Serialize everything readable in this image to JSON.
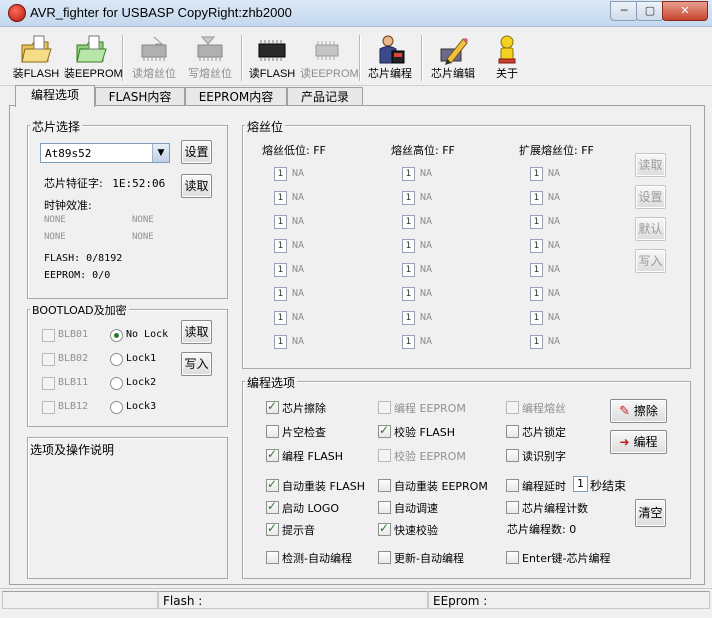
{
  "window": {
    "title": "AVR_fighter for USBASP CopyRight:zhb2000"
  },
  "toolbar": {
    "items": [
      {
        "label": "装FLASH",
        "icon": "folder-open-icon",
        "enabled": true
      },
      {
        "label": "装EEPROM",
        "icon": "folder-open-green-icon",
        "enabled": true
      },
      {
        "label": "读熔丝位",
        "icon": "chip-read-icon",
        "enabled": false
      },
      {
        "label": "写熔丝位",
        "icon": "chip-write-icon",
        "enabled": false
      },
      {
        "label": "读FLASH",
        "icon": "chip-icon",
        "enabled": true
      },
      {
        "label": "读EEPROM",
        "icon": "chip-gray-icon",
        "enabled": false
      },
      {
        "label": "芯片编程",
        "icon": "programmer-person-icon",
        "enabled": true
      },
      {
        "label": "芯片编辑",
        "icon": "pencil-chip-icon",
        "enabled": true
      },
      {
        "label": "关于",
        "icon": "about-person-icon",
        "enabled": true
      }
    ]
  },
  "tabs": [
    {
      "label": "编程选项",
      "active": true
    },
    {
      "label": "FLASH内容",
      "active": false
    },
    {
      "label": "EEPROM内容",
      "active": false
    },
    {
      "label": "产品记录",
      "active": false
    }
  ],
  "chip": {
    "group_label": "芯片选择",
    "selected": "At89s52",
    "set_button": "设置",
    "read_button": "读取",
    "signature_label": "芯片特征字:",
    "signature_value": "1E:52:06",
    "clock_label": "时钟效准:",
    "clock_values": [
      "NONE",
      "NONE",
      "NONE",
      "NONE"
    ],
    "flash_text": "FLASH: 0/8192",
    "eeprom_text": "EEPROM: 0/0"
  },
  "bootload": {
    "group_label": "BOOTLOAD及加密",
    "checks": [
      "BLB01",
      "BLB02",
      "BLB11",
      "BLB12"
    ],
    "locks": [
      {
        "label": "No Lock",
        "selected": true
      },
      {
        "label": "Lock1",
        "selected": false
      },
      {
        "label": "Lock2",
        "selected": false
      },
      {
        "label": "Lock3",
        "selected": false
      }
    ],
    "read_button": "读取",
    "write_button": "写入"
  },
  "desc": {
    "group_label": "选项及操作说明"
  },
  "fuse": {
    "group_label": "熔丝位",
    "headers": [
      "熔丝低位: FF",
      "熔丝高位: FF",
      "扩展熔丝位: FF"
    ],
    "bit_value": "1",
    "na": "NA",
    "buttons": [
      "读取",
      "设置",
      "默认",
      "写入"
    ]
  },
  "prog": {
    "group_label": "编程选项",
    "rows": [
      [
        {
          "label": "芯片擦除",
          "checked": true,
          "enabled": true
        },
        {
          "label": "编程 EEPROM",
          "checked": false,
          "enabled": false
        },
        {
          "label": "编程熔丝",
          "checked": false,
          "enabled": false
        }
      ],
      [
        {
          "label": "片空检查",
          "checked": false,
          "enabled": true
        },
        {
          "label": "校验 FLASH",
          "checked": true,
          "enabled": true
        },
        {
          "label": "芯片锁定",
          "checked": false,
          "enabled": true
        }
      ],
      [
        {
          "label": "编程 FLASH",
          "checked": true,
          "enabled": true
        },
        {
          "label": "校验 EEPROM",
          "checked": false,
          "enabled": false
        },
        {
          "label": "读识别字",
          "checked": false,
          "enabled": true
        }
      ],
      [
        {
          "label": "自动重装 FLASH",
          "checked": true,
          "enabled": true
        },
        {
          "label": "自动重装 EEPROM",
          "checked": false,
          "enabled": true
        },
        {
          "label": "编程延时",
          "checked": false,
          "enabled": true
        }
      ],
      [
        {
          "label": "启动 LOGO",
          "checked": true,
          "enabled": true
        },
        {
          "label": "自动调速",
          "checked": false,
          "enabled": true
        },
        {
          "label": "芯片编程计数",
          "checked": false,
          "enabled": true
        }
      ],
      [
        {
          "label": "提示音",
          "checked": true,
          "enabled": true
        },
        {
          "label": "快速校验",
          "checked": true,
          "enabled": true
        }
      ],
      [
        {
          "label": "检测-自动编程",
          "checked": false,
          "enabled": true
        },
        {
          "label": "更新-自动编程",
          "checked": false,
          "enabled": true
        },
        {
          "label": "Enter键-芯片编程",
          "checked": false,
          "enabled": true
        }
      ]
    ],
    "delay_value": "1",
    "delay_suffix": "秒结束",
    "count_text": "芯片编程数: 0",
    "erase_button": "擦除",
    "program_button": "编程",
    "clear_button": "清空"
  },
  "status": {
    "flash": "Flash :",
    "eeprom": "EEprom :"
  }
}
